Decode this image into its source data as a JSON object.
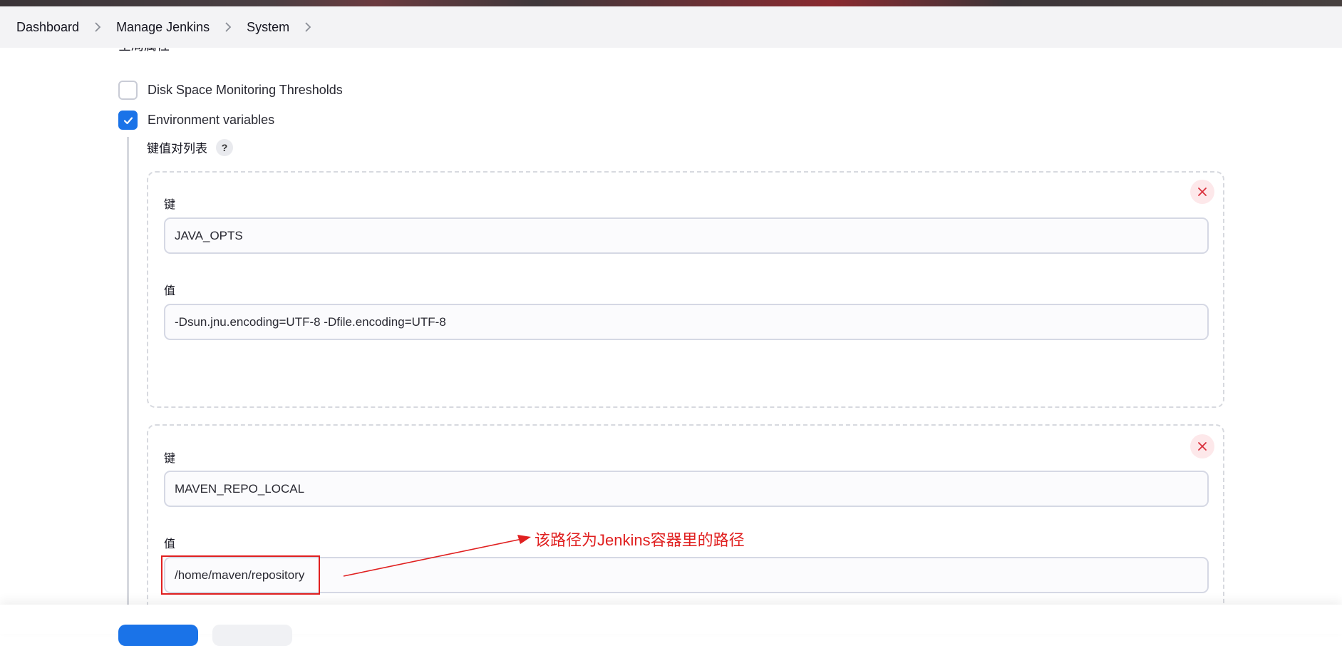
{
  "breadcrumb": {
    "items": [
      "Dashboard",
      "Manage Jenkins",
      "System"
    ]
  },
  "section": {
    "title_cut": "全局属性"
  },
  "options": {
    "disk_space": {
      "label": "Disk Space Monitoring Thresholds",
      "checked": false
    },
    "env_vars": {
      "label": "Environment variables",
      "checked": true
    }
  },
  "kv_list": {
    "title": "键值对列表",
    "help": "?",
    "entries": [
      {
        "key_label": "键",
        "key": "JAVA_OPTS",
        "value_label": "值",
        "value": "-Dsun.jnu.encoding=UTF-8 -Dfile.encoding=UTF-8"
      },
      {
        "key_label": "键",
        "key": "MAVEN_REPO_LOCAL",
        "value_label": "值",
        "value": "/home/maven/repository"
      }
    ]
  },
  "annotation": {
    "text": "该路径为Jenkins容器里的路径",
    "color": "#e02020"
  },
  "colors": {
    "accent": "#1a73e8",
    "danger": "#e02020"
  }
}
